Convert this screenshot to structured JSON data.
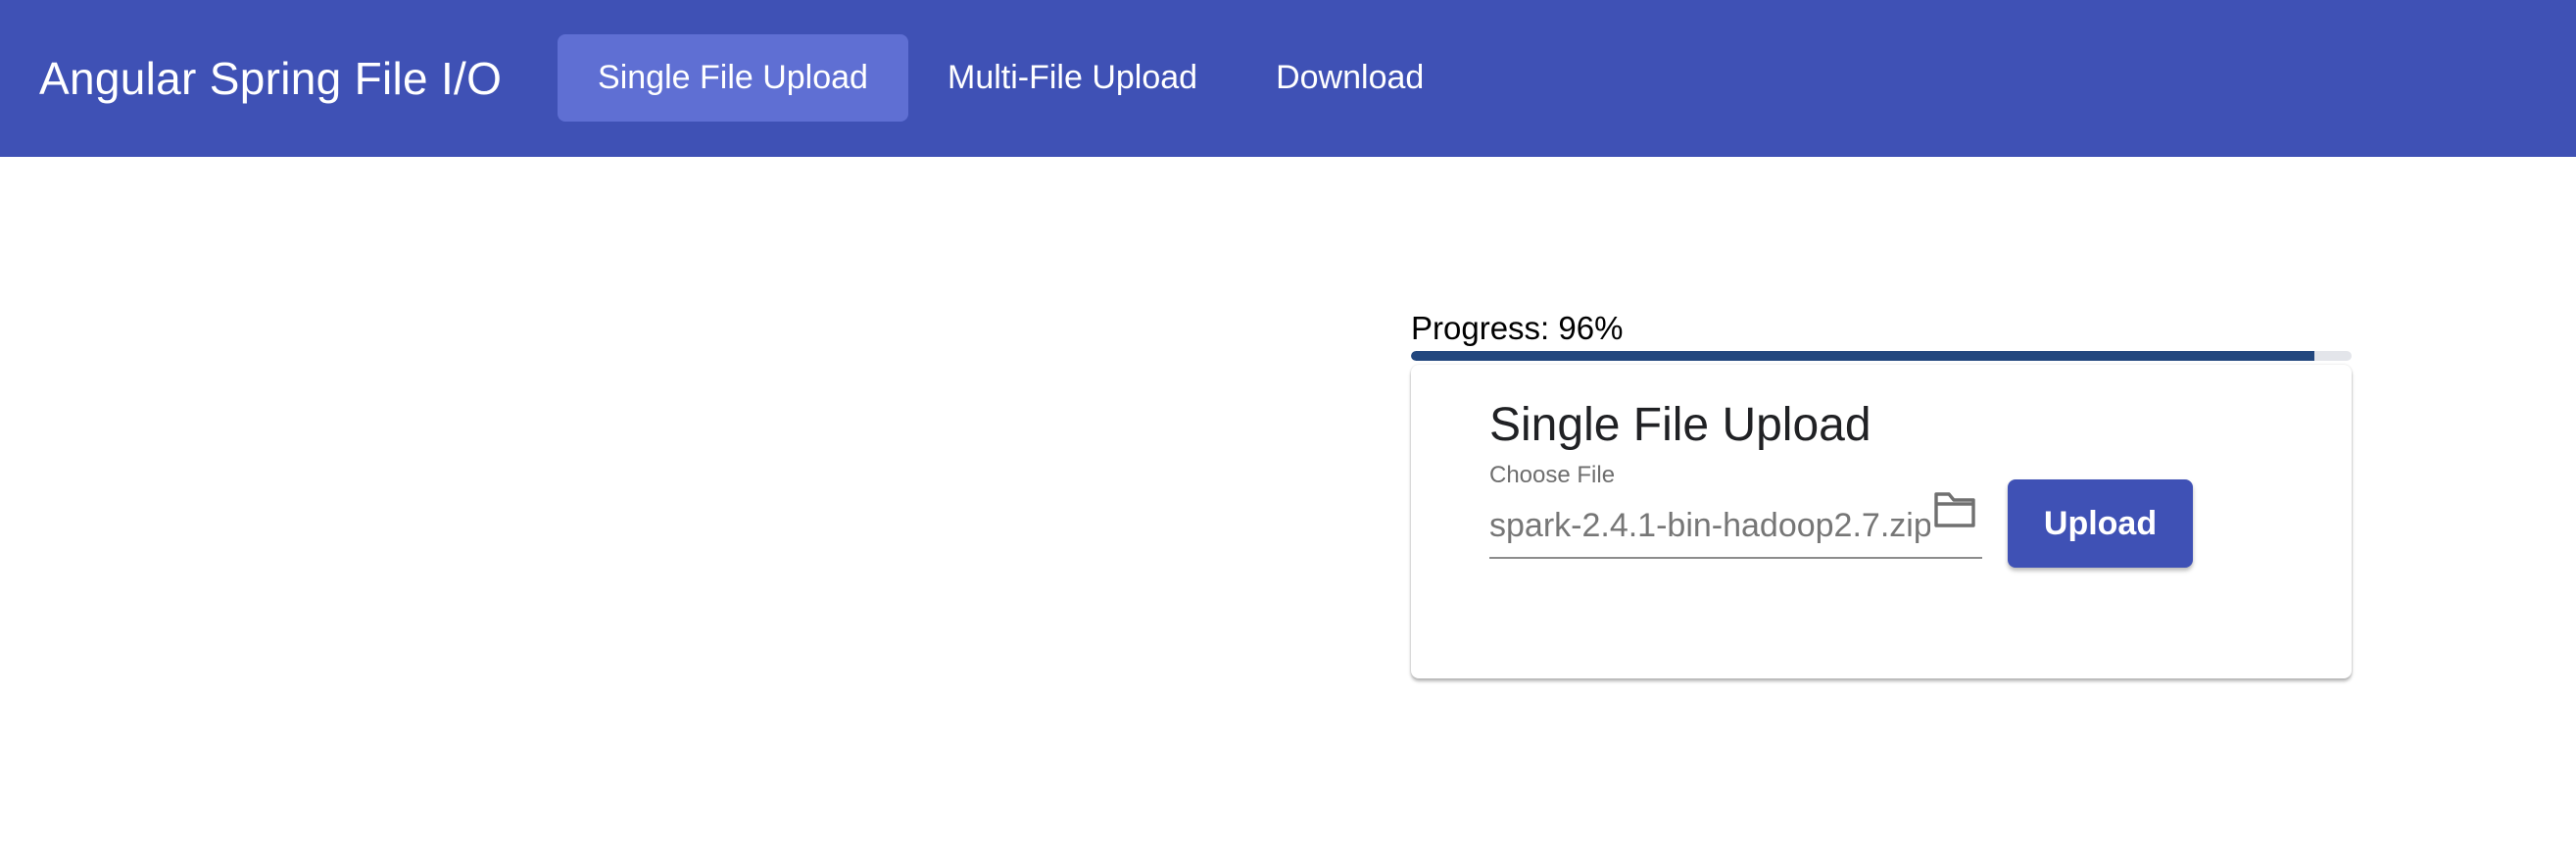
{
  "app": {
    "title": "Angular Spring File I/O"
  },
  "nav": {
    "items": [
      {
        "label": "Single File Upload",
        "active": true
      },
      {
        "label": "Multi-File Upload",
        "active": false
      },
      {
        "label": "Download",
        "active": false
      }
    ]
  },
  "progress": {
    "label": "Progress: 96%",
    "value": 96
  },
  "upload_card": {
    "title": "Single File Upload",
    "field_label": "Choose File",
    "file_value": "spark-2.4.1-bin-hadoop2.7.zip",
    "folder_icon": "folder-icon",
    "button_label": "Upload"
  },
  "colors": {
    "primary": "#3f51b5",
    "active_nav": "#5f6fd3",
    "progress_fill": "#22477e",
    "progress_track": "#e3e5ea"
  }
}
